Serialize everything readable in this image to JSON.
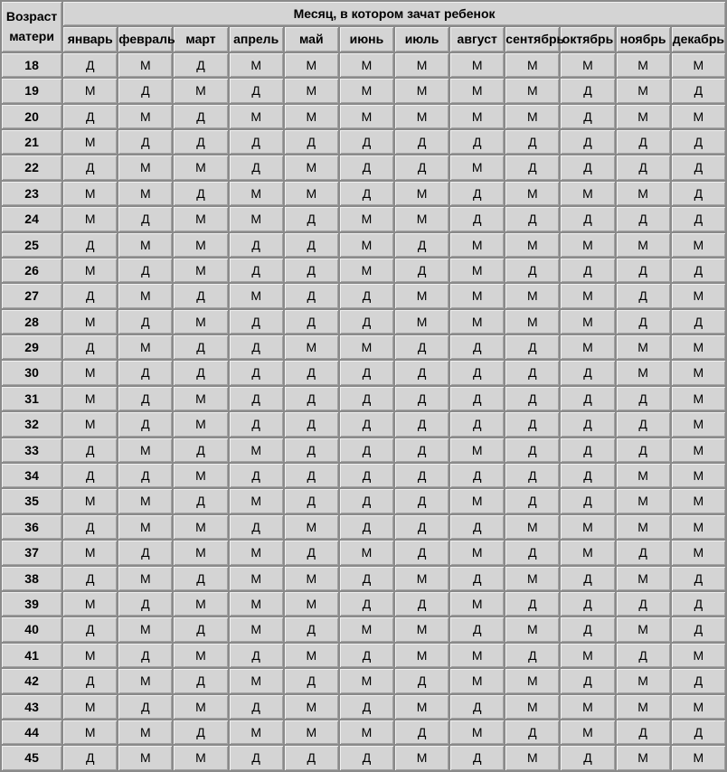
{
  "headers": {
    "age": "Возраст матери",
    "month_group": "Месяц, в котором зачат ребенок",
    "months": [
      "январь",
      "февраль",
      "март",
      "апрель",
      "май",
      "июнь",
      "июль",
      "август",
      "сентябрь",
      "октябрь",
      "ноябрь",
      "декабрь"
    ]
  },
  "rows": [
    {
      "age": "18",
      "cells": [
        "Д",
        "М",
        "Д",
        "М",
        "М",
        "М",
        "М",
        "М",
        "М",
        "М",
        "М",
        "М"
      ]
    },
    {
      "age": "19",
      "cells": [
        "М",
        "Д",
        "М",
        "Д",
        "М",
        "М",
        "М",
        "М",
        "М",
        "Д",
        "М",
        "Д"
      ]
    },
    {
      "age": "20",
      "cells": [
        "Д",
        "М",
        "Д",
        "М",
        "М",
        "М",
        "М",
        "М",
        "М",
        "Д",
        "М",
        "М"
      ]
    },
    {
      "age": "21",
      "cells": [
        "М",
        "Д",
        "Д",
        "Д",
        "Д",
        "Д",
        "Д",
        "Д",
        "Д",
        "Д",
        "Д",
        "Д"
      ]
    },
    {
      "age": "22",
      "cells": [
        "Д",
        "М",
        "М",
        "Д",
        "М",
        "Д",
        "Д",
        "М",
        "Д",
        "Д",
        "Д",
        "Д"
      ]
    },
    {
      "age": "23",
      "cells": [
        "М",
        "М",
        "Д",
        "М",
        "М",
        "Д",
        "М",
        "Д",
        "М",
        "М",
        "М",
        "Д"
      ]
    },
    {
      "age": "24",
      "cells": [
        "М",
        "Д",
        "М",
        "М",
        "Д",
        "М",
        "М",
        "Д",
        "Д",
        "Д",
        "Д",
        "Д"
      ]
    },
    {
      "age": "25",
      "cells": [
        "Д",
        "М",
        "М",
        "Д",
        "Д",
        "М",
        "Д",
        "М",
        "М",
        "М",
        "М",
        "М"
      ]
    },
    {
      "age": "26",
      "cells": [
        "М",
        "Д",
        "М",
        "Д",
        "Д",
        "М",
        "Д",
        "М",
        "Д",
        "Д",
        "Д",
        "Д"
      ]
    },
    {
      "age": "27",
      "cells": [
        "Д",
        "М",
        "Д",
        "М",
        "Д",
        "Д",
        "М",
        "М",
        "М",
        "М",
        "Д",
        "М"
      ]
    },
    {
      "age": "28",
      "cells": [
        "М",
        "Д",
        "М",
        "Д",
        "Д",
        "Д",
        "М",
        "М",
        "М",
        "М",
        "Д",
        "Д"
      ]
    },
    {
      "age": "29",
      "cells": [
        "Д",
        "М",
        "Д",
        "Д",
        "М",
        "М",
        "Д",
        "Д",
        "Д",
        "М",
        "М",
        "М"
      ]
    },
    {
      "age": "30",
      "cells": [
        "М",
        "Д",
        "Д",
        "Д",
        "Д",
        "Д",
        "Д",
        "Д",
        "Д",
        "Д",
        "М",
        "М"
      ]
    },
    {
      "age": "31",
      "cells": [
        "М",
        "Д",
        "М",
        "Д",
        "Д",
        "Д",
        "Д",
        "Д",
        "Д",
        "Д",
        "Д",
        "М"
      ]
    },
    {
      "age": "32",
      "cells": [
        "М",
        "Д",
        "М",
        "Д",
        "Д",
        "Д",
        "Д",
        "Д",
        "Д",
        "Д",
        "Д",
        "М"
      ]
    },
    {
      "age": "33",
      "cells": [
        "Д",
        "М",
        "Д",
        "М",
        "Д",
        "Д",
        "Д",
        "М",
        "Д",
        "Д",
        "Д",
        "М"
      ]
    },
    {
      "age": "34",
      "cells": [
        "Д",
        "Д",
        "М",
        "Д",
        "Д",
        "Д",
        "Д",
        "Д",
        "Д",
        "Д",
        "М",
        "М"
      ]
    },
    {
      "age": "35",
      "cells": [
        "М",
        "М",
        "Д",
        "М",
        "Д",
        "Д",
        "Д",
        "М",
        "Д",
        "Д",
        "М",
        "М"
      ]
    },
    {
      "age": "36",
      "cells": [
        "Д",
        "М",
        "М",
        "Д",
        "М",
        "Д",
        "Д",
        "Д",
        "М",
        "М",
        "М",
        "М"
      ]
    },
    {
      "age": "37",
      "cells": [
        "М",
        "Д",
        "М",
        "М",
        "Д",
        "М",
        "Д",
        "М",
        "Д",
        "М",
        "Д",
        "М"
      ]
    },
    {
      "age": "38",
      "cells": [
        "Д",
        "М",
        "Д",
        "М",
        "М",
        "Д",
        "М",
        "Д",
        "М",
        "Д",
        "М",
        "Д"
      ]
    },
    {
      "age": "39",
      "cells": [
        "М",
        "Д",
        "М",
        "М",
        "М",
        "Д",
        "Д",
        "М",
        "Д",
        "Д",
        "Д",
        "Д"
      ]
    },
    {
      "age": "40",
      "cells": [
        "Д",
        "М",
        "Д",
        "М",
        "Д",
        "М",
        "М",
        "Д",
        "М",
        "Д",
        "М",
        "Д"
      ]
    },
    {
      "age": "41",
      "cells": [
        "М",
        "Д",
        "М",
        "Д",
        "М",
        "Д",
        "М",
        "М",
        "Д",
        "М",
        "Д",
        "М"
      ]
    },
    {
      "age": "42",
      "cells": [
        "Д",
        "М",
        "Д",
        "М",
        "Д",
        "М",
        "Д",
        "М",
        "М",
        "Д",
        "М",
        "Д"
      ]
    },
    {
      "age": "43",
      "cells": [
        "М",
        "Д",
        "М",
        "Д",
        "М",
        "Д",
        "М",
        "Д",
        "М",
        "М",
        "М",
        "М"
      ]
    },
    {
      "age": "44",
      "cells": [
        "М",
        "М",
        "Д",
        "М",
        "М",
        "М",
        "Д",
        "М",
        "Д",
        "М",
        "Д",
        "Д"
      ]
    },
    {
      "age": "45",
      "cells": [
        "Д",
        "М",
        "М",
        "Д",
        "Д",
        "Д",
        "М",
        "Д",
        "М",
        "Д",
        "М",
        "М"
      ]
    }
  ]
}
